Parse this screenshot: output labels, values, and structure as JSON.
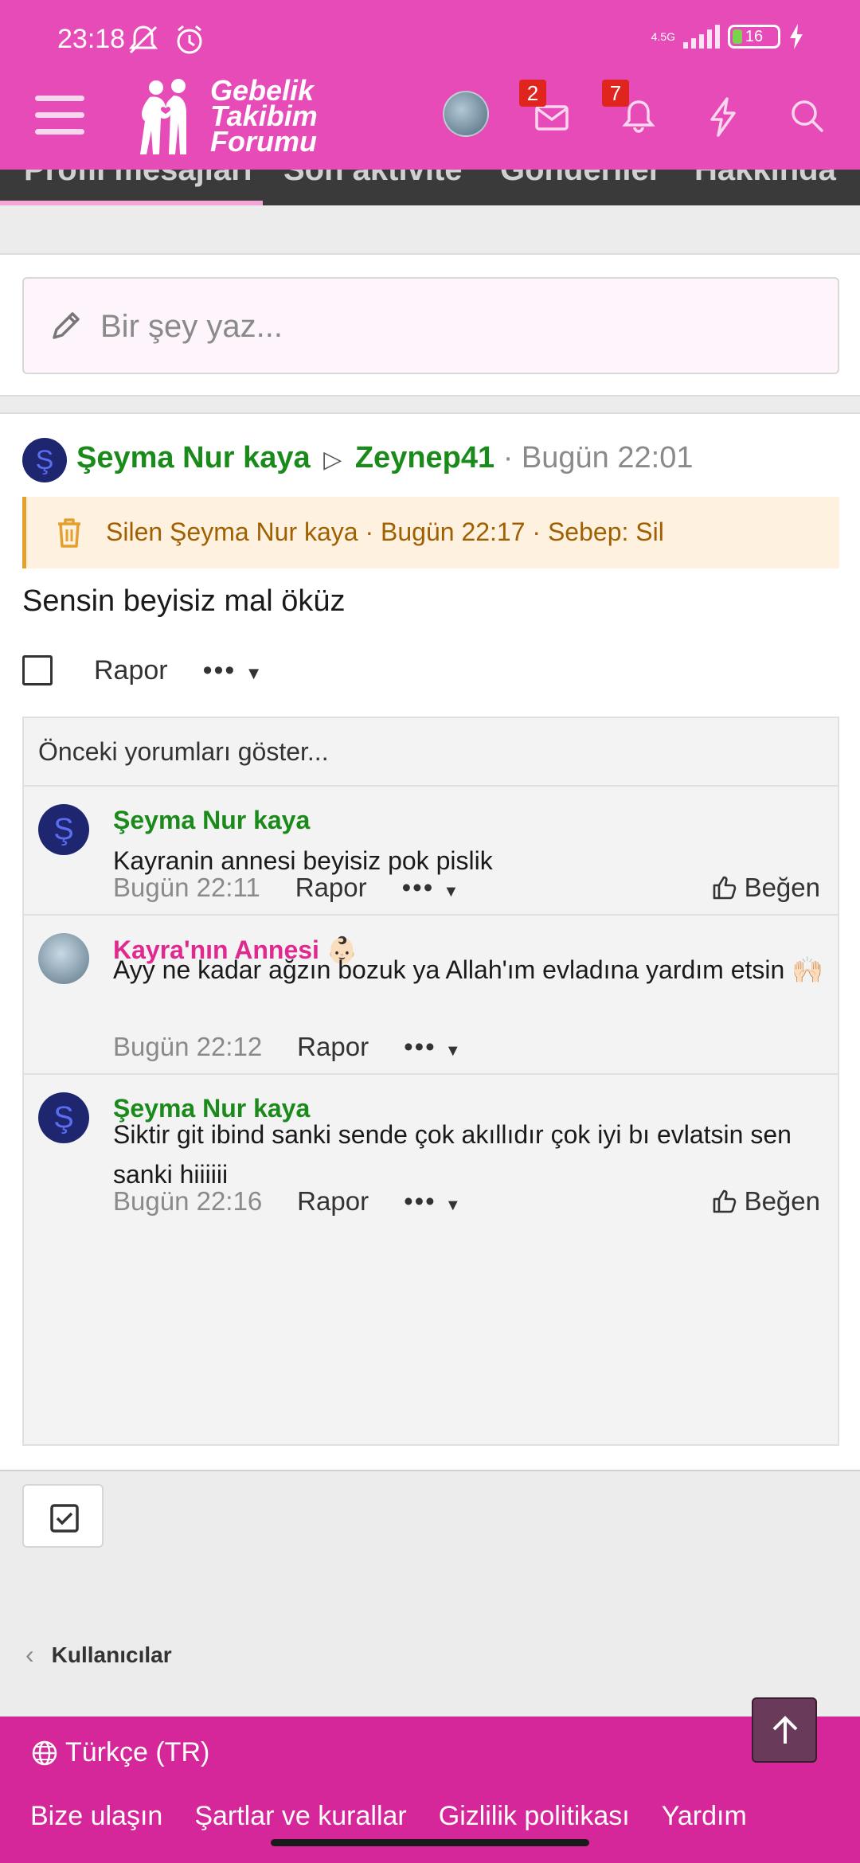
{
  "status_bar": {
    "time": "23:18",
    "network": "4.5G",
    "battery": "16"
  },
  "header": {
    "logo_lines": [
      "Gebelik",
      "Takibim",
      "Forumu"
    ],
    "messages_badge": "2",
    "alerts_badge": "7"
  },
  "tabs": [
    "Profil mesajları",
    "Son aktivite",
    "Gönderiler",
    "Hakkında"
  ],
  "composer": {
    "placeholder": "Bir şey yaz..."
  },
  "post": {
    "avatar_letter": "Ş",
    "author": "Şeyma Nur kaya",
    "recipient": "Zeynep41",
    "time": "· Bugün 22:01",
    "deleted_notice": "Silen Şeyma Nur kaya · Bugün 22:17 · Sebep: Sil",
    "body": "Sensin beyisiz mal öküz",
    "report_label": "Rapor",
    "more_label": "•••"
  },
  "comments": {
    "show_previous": "Önceki yorumları göster...",
    "items": [
      {
        "avatar_letter": "Ş",
        "author": "Şeyma Nur kaya",
        "text": "Kayranin annesi beyisiz pok pislik",
        "time": "Bugün 22:11",
        "report": "Rapor",
        "more": "•••",
        "like": "Beğen"
      },
      {
        "author": "Kayra'nın Annesi 👶🏻",
        "text": "Ayy ne kadar ağzın bozuk ya Allah'ım evladına yardım etsin 🙌🏻",
        "time": "Bugün 22:12",
        "report": "Rapor",
        "more": "•••"
      },
      {
        "avatar_letter": "Ş",
        "author": "Şeyma Nur kaya",
        "text": "Siktir git ibind sanki sende çok akıllıdır çok iyi bı evlatsin sen sanki hiiiiii",
        "time": "Bugün 22:16",
        "report": "Rapor",
        "more": "•••",
        "like": "Beğen"
      }
    ]
  },
  "breadcrumb": {
    "label": "Kullanıcılar"
  },
  "footer": {
    "language": "Türkçe (TR)",
    "links": [
      "Bize ulaşın",
      "Şartlar ve kurallar",
      "Gizlilik politikası",
      "Yardım"
    ]
  },
  "colors": {
    "brand_pink": "#e64bb8",
    "footer_pink": "#d6279a",
    "username_green": "#1a8a1a"
  }
}
